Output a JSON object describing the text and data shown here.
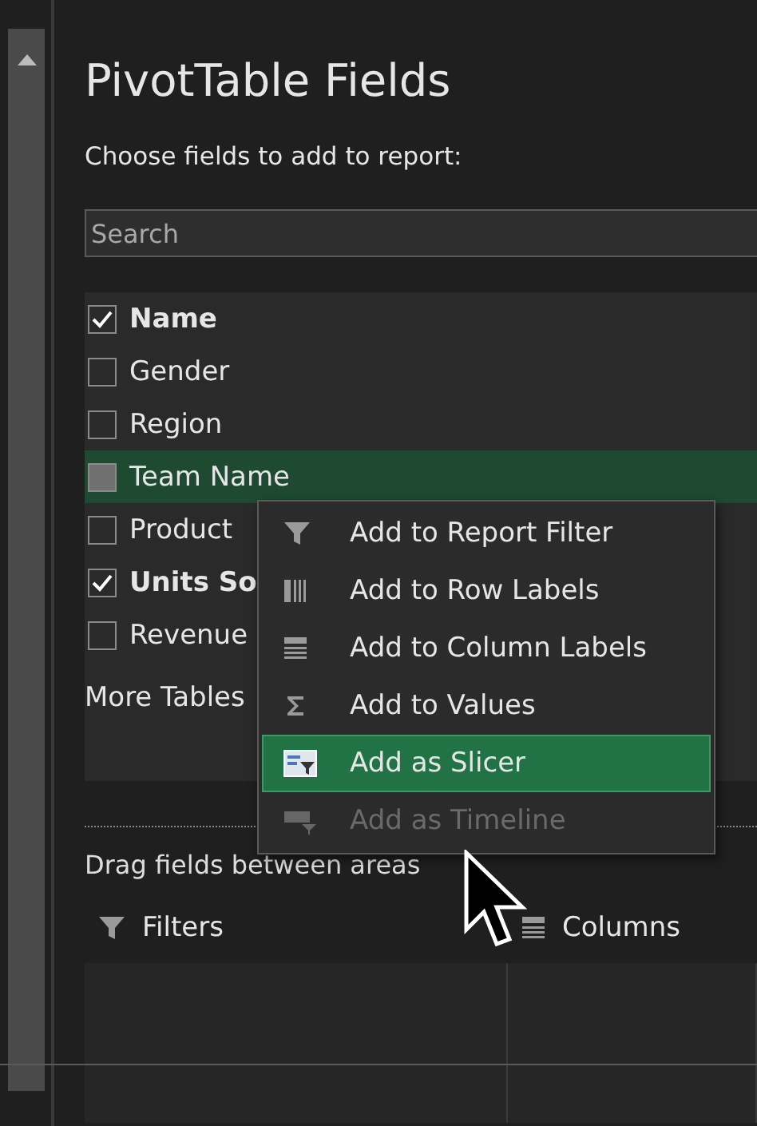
{
  "panel": {
    "title": "PivotTable Fields",
    "subtitle": "Choose fields to add to report:"
  },
  "search": {
    "placeholder": "Search"
  },
  "fields": [
    {
      "label": "Name",
      "checked": true,
      "selected": false
    },
    {
      "label": "Gender",
      "checked": false,
      "selected": false
    },
    {
      "label": "Region",
      "checked": false,
      "selected": false
    },
    {
      "label": "Team Name",
      "checked": false,
      "selected": true
    },
    {
      "label": "Product",
      "checked": false,
      "selected": false
    },
    {
      "label": "Units So",
      "checked": true,
      "selected": false
    },
    {
      "label": "Revenue",
      "checked": false,
      "selected": false
    }
  ],
  "more_tables": "More Tables",
  "context_menu": [
    {
      "label": "Add to Report Filter",
      "kind": "filter",
      "selected": false,
      "disabled": false
    },
    {
      "label": "Add to Row Labels",
      "kind": "rows",
      "selected": false,
      "disabled": false
    },
    {
      "label": "Add to Column Labels",
      "kind": "columns",
      "selected": false,
      "disabled": false
    },
    {
      "label": "Add to Values",
      "kind": "sigma",
      "selected": false,
      "disabled": false
    },
    {
      "label": "Add as Slicer",
      "kind": "slicer",
      "selected": true,
      "disabled": false
    },
    {
      "label": "Add as Timeline",
      "kind": "timeline",
      "selected": false,
      "disabled": true
    }
  ],
  "drag_hint": "Drag fields between areas",
  "areas": [
    {
      "label": "Filters",
      "kind": "filter"
    },
    {
      "label": "Columns",
      "kind": "columns"
    }
  ]
}
